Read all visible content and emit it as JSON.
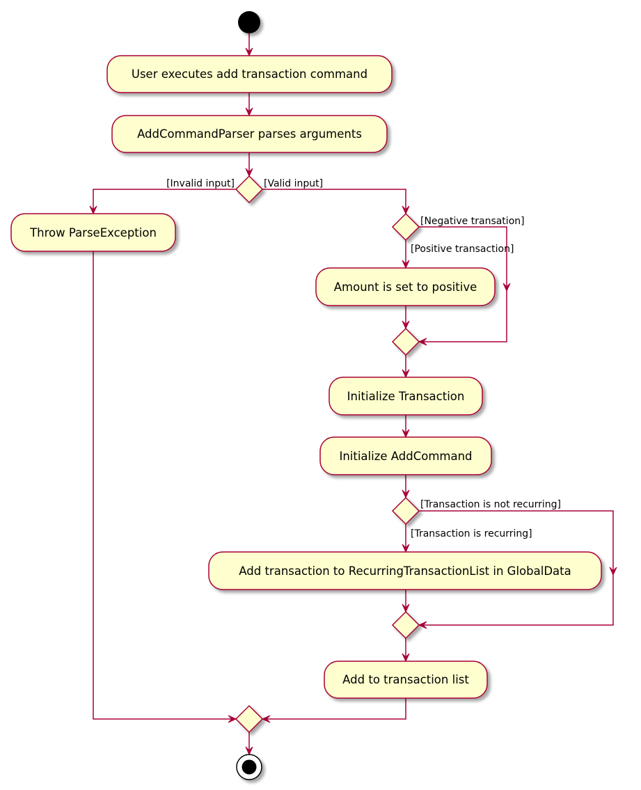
{
  "diagram": {
    "type": "uml-activity",
    "colors": {
      "line": "#A80036",
      "fill": "#FEFECE",
      "node": "#000000",
      "background": "#FFFFFF"
    },
    "activities": {
      "user_executes": "User executes add transaction command",
      "parser_parses": "AddCommandParser parses arguments",
      "throw_parse_exception": "Throw ParseException",
      "amount_positive": "Amount is set to positive",
      "init_transaction": "Initialize Transaction",
      "init_add_command": "Initialize AddCommand",
      "add_recurring": "Add transaction to RecurringTransactionList in GlobalData",
      "add_to_list": "Add to transaction list"
    },
    "guards": {
      "invalid_input": "[Invalid input]",
      "valid_input": "[Valid input]",
      "negative_transaction": "[Negative transation]",
      "positive_transaction": "[Positive transaction]",
      "not_recurring": "[Transaction is not recurring]",
      "is_recurring": "[Transaction is recurring]"
    },
    "nodes": {
      "start": "start-node",
      "end": "end-node"
    }
  }
}
